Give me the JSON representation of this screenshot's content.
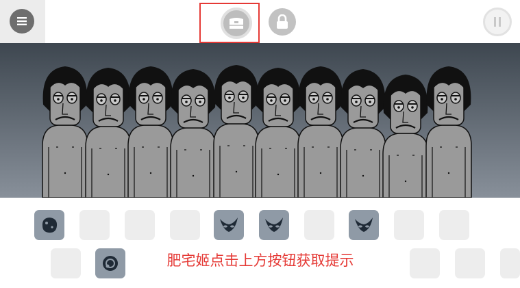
{
  "toolbar": {
    "menu_icon": "hamburger-icon",
    "bonus_icon": "bonus-chest-icon",
    "lock_icon": "lock-icon",
    "pause_icon": "pause-icon"
  },
  "stage": {
    "character_count": 10,
    "skin_color": "#9a9a9a",
    "background_top": "#3e4750",
    "background_bottom": "#88909a"
  },
  "tray": {
    "top_row": [
      {
        "filled": true,
        "icon": "dark-blob-icon"
      },
      {
        "filled": false
      },
      {
        "filled": false
      },
      {
        "filled": false
      },
      {
        "filled": true,
        "icon": "mask-icon"
      },
      {
        "filled": true,
        "icon": "mask-icon"
      },
      {
        "filled": false
      },
      {
        "filled": true,
        "icon": "mask-icon"
      },
      {
        "filled": false
      },
      {
        "filled": false
      }
    ],
    "bottom_row": [
      {
        "filled": false
      },
      {
        "filled": true,
        "icon": "swirl-icon"
      }
    ]
  },
  "hint": {
    "text": "肥宅姬点击上方按钮获取提示",
    "color": "#e53935"
  }
}
